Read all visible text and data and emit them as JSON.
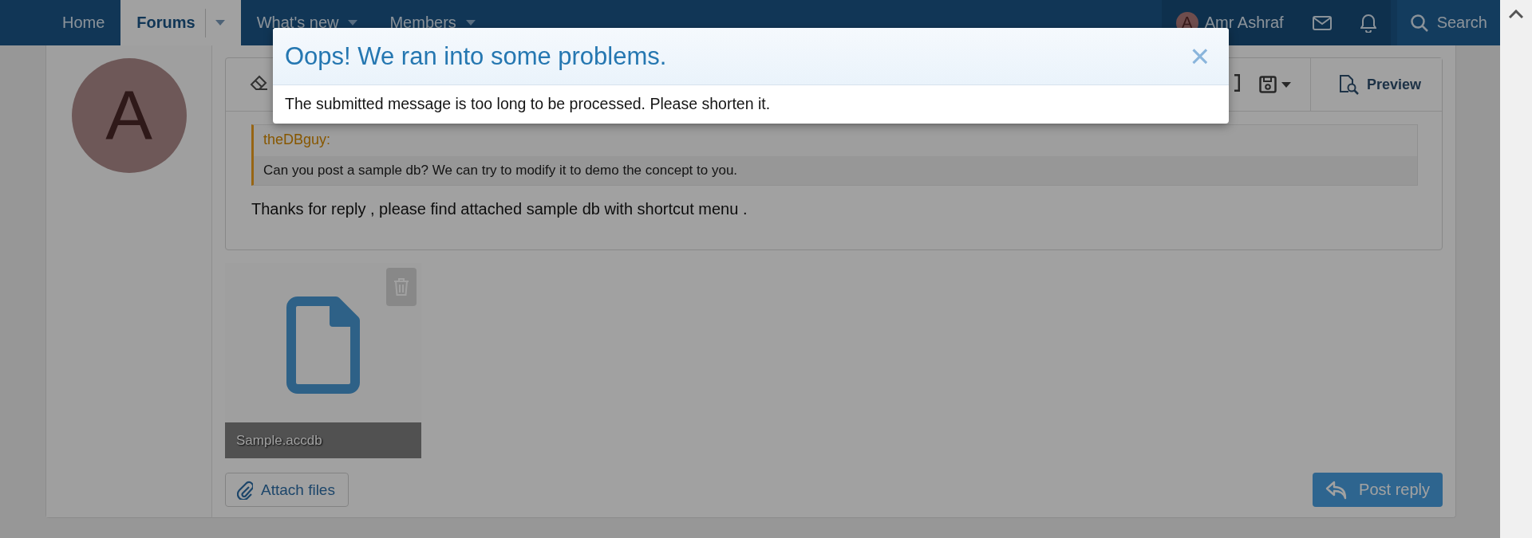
{
  "nav": {
    "items": [
      {
        "label": "Home",
        "selected": false,
        "dropdown": false
      },
      {
        "label": "Forums",
        "selected": true,
        "dropdown": true
      },
      {
        "label": "What's new",
        "selected": false,
        "dropdown": true
      },
      {
        "label": "Members",
        "selected": false,
        "dropdown": true
      }
    ],
    "user": {
      "avatar_letter": "A",
      "name": "Amr Ashraf"
    },
    "search": "Search"
  },
  "post": {
    "avatar_letter": "A",
    "editor": {
      "preview": "Preview",
      "quote": {
        "author": "theDBguy:",
        "text": "Can you post a sample db? We can try to modify it to demo the concept to you."
      },
      "message": "Thanks for reply , please find attached sample db with shortcut menu ."
    },
    "attachments": [
      {
        "filename": "Sample.accdb"
      }
    ],
    "buttons": {
      "attach": "Attach files",
      "submit": "Post reply"
    }
  },
  "modal": {
    "title": "Oops! We ran into some problems.",
    "message": "The submitted message is too long to be processed. Please shorten it.",
    "close": "×"
  }
}
